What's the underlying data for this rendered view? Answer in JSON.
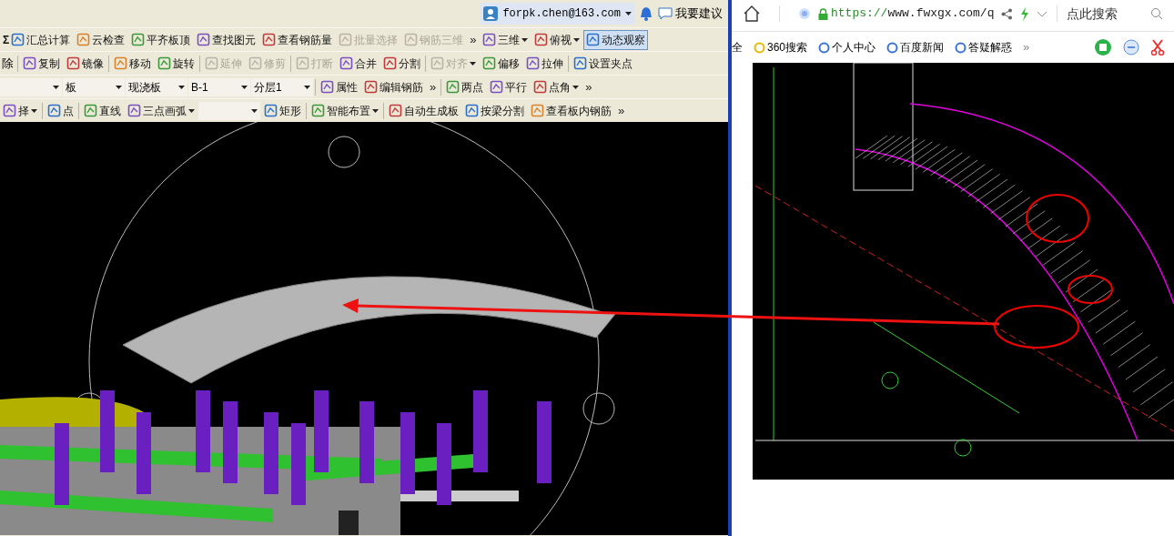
{
  "account": {
    "email": "forpk.chen@163.com",
    "feedback": "我要建议"
  },
  "toolbars": [
    {
      "items": [
        {
          "kind": "button",
          "symbol": "Σ",
          "label": "汇总计算",
          "disabled": false,
          "active": false
        },
        {
          "kind": "button",
          "label": "云检查",
          "disabled": false,
          "active": false
        },
        {
          "kind": "button",
          "label": "平齐板顶",
          "disabled": false,
          "active": false
        },
        {
          "kind": "button",
          "label": "查找图元",
          "disabled": false,
          "active": false
        },
        {
          "kind": "button",
          "label": "查看钢筋量",
          "disabled": false,
          "active": false
        },
        {
          "kind": "button",
          "label": "批量选择",
          "disabled": true,
          "active": false
        },
        {
          "kind": "button",
          "label": "钢筋三维",
          "disabled": true,
          "active": false
        },
        {
          "kind": "overflow",
          "label": "»"
        },
        {
          "kind": "menu-button",
          "label": "三维",
          "disabled": false,
          "active": false
        },
        {
          "kind": "menu-button",
          "label": "俯视",
          "disabled": false,
          "active": false
        },
        {
          "kind": "button",
          "label": "动态观察",
          "disabled": false,
          "active": true
        }
      ]
    },
    {
      "items": [
        {
          "kind": "text",
          "label": "除"
        },
        {
          "kind": "separator"
        },
        {
          "kind": "button",
          "label": "复制",
          "disabled": false,
          "active": false
        },
        {
          "kind": "button",
          "label": "镜像",
          "disabled": false,
          "active": false
        },
        {
          "kind": "separator"
        },
        {
          "kind": "button",
          "label": "移动",
          "disabled": false,
          "active": false
        },
        {
          "kind": "button",
          "label": "旋转",
          "disabled": false,
          "active": false
        },
        {
          "kind": "separator"
        },
        {
          "kind": "button",
          "label": "延伸",
          "disabled": true,
          "active": false
        },
        {
          "kind": "button",
          "label": "修剪",
          "disabled": true,
          "active": false
        },
        {
          "kind": "separator"
        },
        {
          "kind": "button",
          "label": "打断",
          "disabled": true,
          "active": false
        },
        {
          "kind": "button",
          "label": "合并",
          "disabled": false,
          "active": false
        },
        {
          "kind": "button",
          "label": "分割",
          "disabled": false,
          "active": false
        },
        {
          "kind": "separator"
        },
        {
          "kind": "menu-button",
          "label": "对齐",
          "disabled": true,
          "active": false
        },
        {
          "kind": "button",
          "label": "偏移",
          "disabled": false,
          "active": false
        },
        {
          "kind": "button",
          "label": "拉伸",
          "disabled": false,
          "active": false
        },
        {
          "kind": "separator"
        },
        {
          "kind": "button",
          "label": "设置夹点",
          "disabled": false,
          "active": false
        }
      ]
    },
    {
      "items": [
        {
          "kind": "combo"
        },
        {
          "kind": "combo",
          "label": "板"
        },
        {
          "kind": "combo",
          "label": "现浇板"
        },
        {
          "kind": "combo",
          "label": "B-1"
        },
        {
          "kind": "combo",
          "label": "分层1"
        },
        {
          "kind": "separator"
        },
        {
          "kind": "button",
          "label": "属性",
          "disabled": false,
          "active": false
        },
        {
          "kind": "button",
          "label": "编辑钢筋",
          "disabled": false,
          "active": false
        },
        {
          "kind": "overflow",
          "label": "»"
        },
        {
          "kind": "separator"
        },
        {
          "kind": "button",
          "label": "两点",
          "disabled": false,
          "active": false
        },
        {
          "kind": "button",
          "label": "平行",
          "disabled": false,
          "active": false
        },
        {
          "kind": "menu-button",
          "label": "点角",
          "disabled": false,
          "active": false
        },
        {
          "kind": "overflow",
          "label": "»"
        }
      ]
    },
    {
      "items": [
        {
          "kind": "menu-button",
          "label": "择",
          "disabled": false,
          "active": false
        },
        {
          "kind": "separator"
        },
        {
          "kind": "button",
          "label": "点",
          "disabled": false,
          "active": false
        },
        {
          "kind": "separator"
        },
        {
          "kind": "button",
          "label": "直线",
          "disabled": false,
          "active": false
        },
        {
          "kind": "menu-button",
          "label": "三点画弧",
          "disabled": false,
          "active": false
        },
        {
          "kind": "combo"
        },
        {
          "kind": "button",
          "label": "矩形",
          "disabled": false,
          "active": false
        },
        {
          "kind": "separator"
        },
        {
          "kind": "menu-button",
          "label": "智能布置",
          "disabled": false,
          "active": false
        },
        {
          "kind": "separator"
        },
        {
          "kind": "button",
          "label": "自动生成板",
          "disabled": false,
          "active": false
        },
        {
          "kind": "button",
          "label": "按梁分割",
          "disabled": false,
          "active": false
        },
        {
          "kind": "button",
          "label": "查看板内钢筋",
          "disabled": false,
          "active": false
        },
        {
          "kind": "overflow",
          "label": "»"
        }
      ]
    }
  ],
  "browser": {
    "url_scheme": "https://",
    "url_rest": "www.fwxgx.com/q",
    "search_placeholder": "点此搜索",
    "bookmarks": [
      "全",
      "360搜索",
      "个人中心",
      "百度新闻",
      "答疑解惑"
    ],
    "bookmarks_more": "»"
  }
}
